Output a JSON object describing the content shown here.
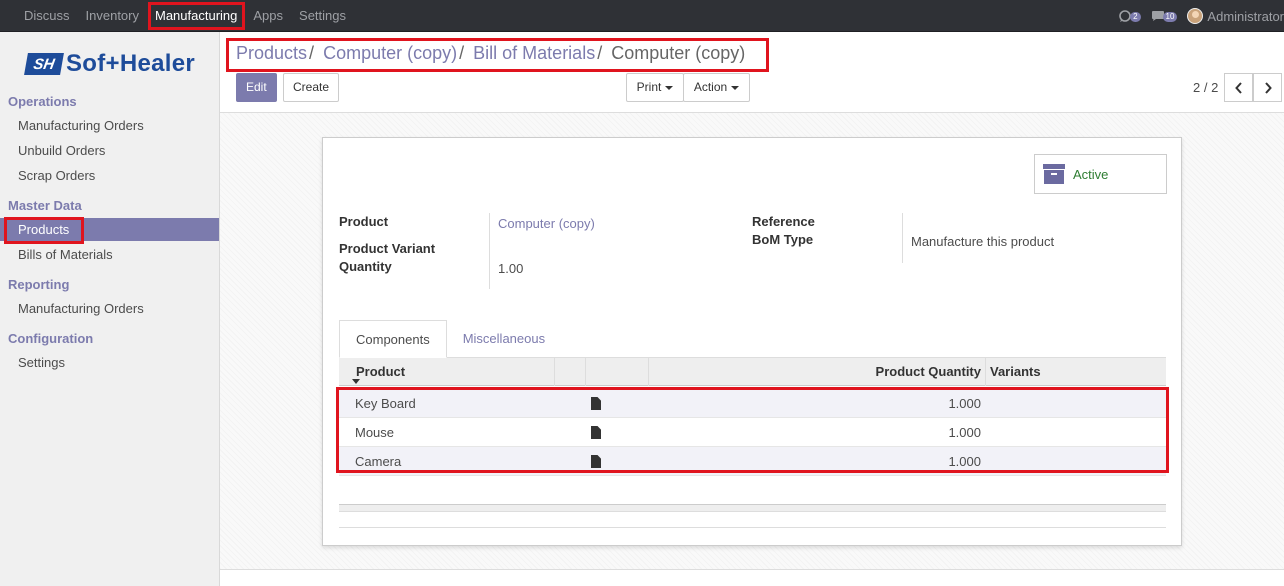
{
  "topbar": {
    "menu": [
      "Discuss",
      "Inventory",
      "Manufacturing",
      "Apps",
      "Settings"
    ],
    "active_menu": "Manufacturing",
    "chat_badge": "2",
    "messages_badge": "10",
    "user_name": "Administrator"
  },
  "sidebar": {
    "logo_mark": "SH",
    "logo_text": "Sof+Healer",
    "sections": {
      "operations": "Operations",
      "master_data": "Master Data",
      "reporting": "Reporting",
      "configuration": "Configuration"
    },
    "items": {
      "manufacturing_orders": "Manufacturing Orders",
      "unbuild_orders": "Unbuild Orders",
      "scrap_orders": "Scrap Orders",
      "products": "Products",
      "bills_of_materials": "Bills of Materials",
      "reporting_mo": "Manufacturing Orders",
      "settings": "Settings"
    }
  },
  "breadcrumb": {
    "items": [
      "Products",
      "Computer (copy)",
      "Bill of Materials"
    ],
    "current": "Computer (copy)",
    "separator": "/"
  },
  "toolbar": {
    "edit": "Edit",
    "create": "Create",
    "print": "Print",
    "action": "Action",
    "pager": "2 / 2"
  },
  "form": {
    "active_label": "Active",
    "fields": {
      "product_label": "Product",
      "product_value": "Computer (copy)",
      "variant_label": "Product Variant",
      "quantity_label": "Quantity",
      "quantity_value": "1.00",
      "reference_label": "Reference",
      "bom_type_label": "BoM Type",
      "bom_type_value": "Manufacture this product"
    },
    "tabs": [
      "Components",
      "Miscellaneous"
    ],
    "table": {
      "headers": {
        "product": "Product",
        "quantity": "Product Quantity",
        "variants": "Variants"
      },
      "rows": [
        {
          "product": "Key Board",
          "quantity": "1.000"
        },
        {
          "product": "Mouse",
          "quantity": "1.000"
        },
        {
          "product": "Camera",
          "quantity": "1.000"
        }
      ]
    }
  },
  "colors": {
    "accent": "#7c7bad",
    "topbar": "#2f3136",
    "highlight": "#e0141e",
    "active_green": "#2e7d32"
  },
  "icons": [
    "chat-icon",
    "messages-icon",
    "archive-icon",
    "document-icon",
    "chevron-left-icon",
    "chevron-right-icon",
    "caret-down-icon"
  ]
}
